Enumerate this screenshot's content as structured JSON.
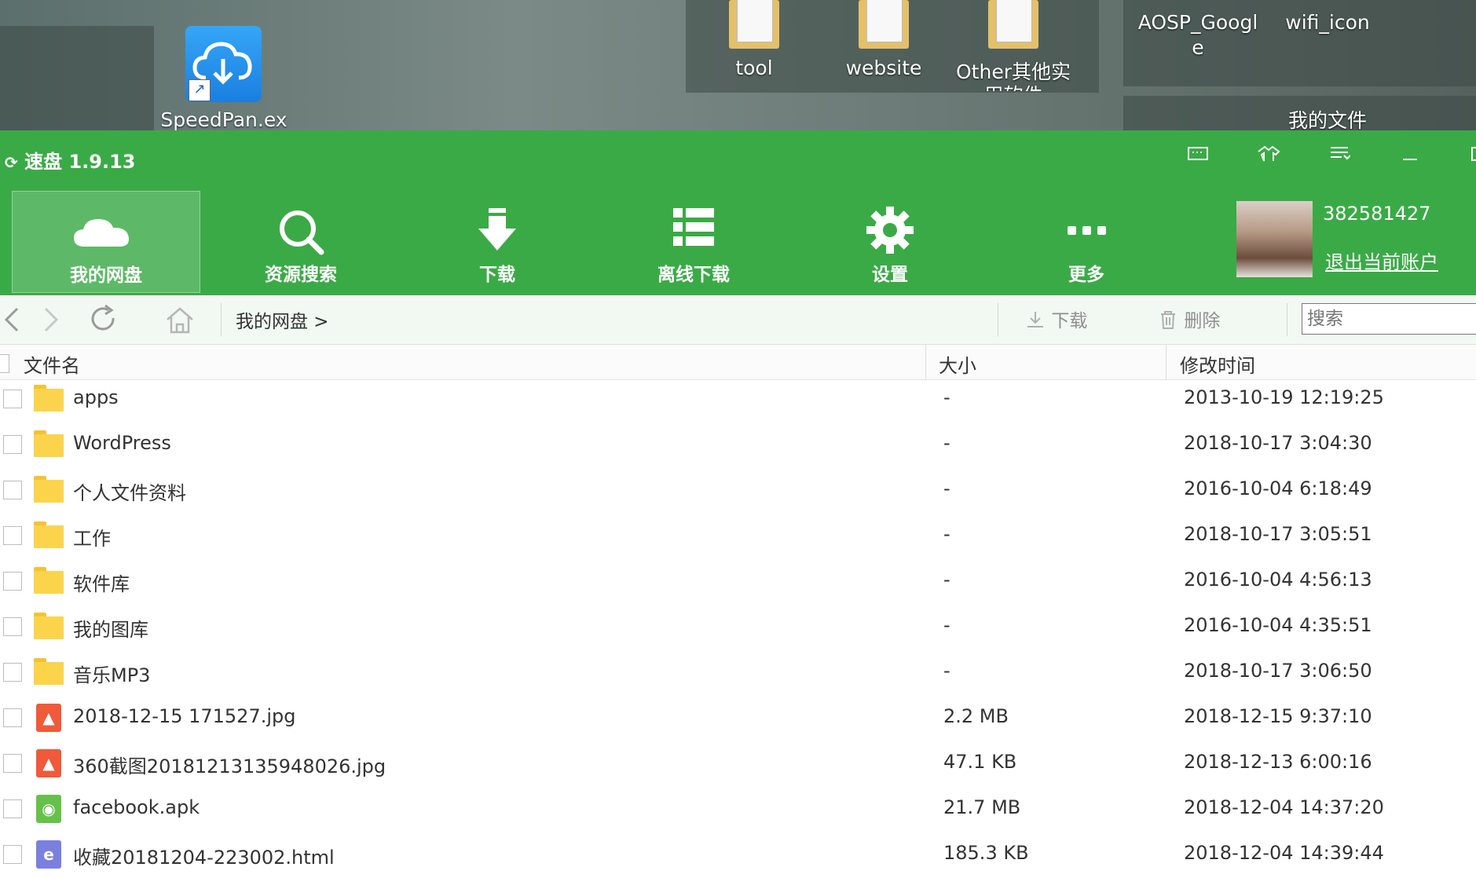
{
  "desktop": {
    "speedpan_label": "SpeedPan.ex",
    "tool_label": "tool",
    "website_label": "website",
    "other_label": "Other其他实",
    "other_label2": "用软件",
    "aosp_label": "AOSP_Googl",
    "aosp_label2": "e",
    "wifi_label": "wifi_icon",
    "myfiles_label": "我的文件"
  },
  "app": {
    "title": "速盘 1.9.13",
    "accent": "#3aaa46"
  },
  "toolbar": {
    "items": [
      {
        "label": "我的网盘",
        "icon": "cloud-icon"
      },
      {
        "label": "资源搜索",
        "icon": "search-icon"
      },
      {
        "label": "下载",
        "icon": "download-arrow-icon"
      },
      {
        "label": "离线下载",
        "icon": "list-icon"
      },
      {
        "label": "设置",
        "icon": "gear-icon"
      },
      {
        "label": "更多",
        "icon": "more-dots-icon"
      }
    ]
  },
  "user": {
    "id": "382581427",
    "logout": "退出当前账户"
  },
  "nav": {
    "breadcrumb": "我的网盘 >",
    "download": "下载",
    "delete": "删除",
    "search_placeholder": "搜索"
  },
  "columns": {
    "name": "文件名",
    "size": "大小",
    "modified": "修改时间"
  },
  "files": [
    {
      "name": "apps",
      "size": "-",
      "time": "2013-10-19 12:19:25",
      "type": "folder"
    },
    {
      "name": "WordPress",
      "size": "-",
      "time": "2018-10-17 3:04:30",
      "type": "folder"
    },
    {
      "name": "个人文件资料",
      "size": "-",
      "time": "2016-10-04 6:18:49",
      "type": "folder"
    },
    {
      "name": "工作",
      "size": "-",
      "time": "2018-10-17 3:05:51",
      "type": "folder"
    },
    {
      "name": "软件库",
      "size": "-",
      "time": "2016-10-04 4:56:13",
      "type": "folder"
    },
    {
      "name": "我的图库",
      "size": "-",
      "time": "2016-10-04 4:35:51",
      "type": "folder"
    },
    {
      "name": "音乐MP3",
      "size": "-",
      "time": "2018-10-17 3:06:50",
      "type": "folder"
    },
    {
      "name": "2018-12-15 171527.jpg",
      "size": "2.2 MB",
      "time": "2018-12-15 9:37:10",
      "type": "image"
    },
    {
      "name": "360截图20181213135948026.jpg",
      "size": "47.1 KB",
      "time": "2018-12-13 6:00:16",
      "type": "image"
    },
    {
      "name": "facebook.apk",
      "size": "21.7 MB",
      "time": "2018-12-04 14:37:20",
      "type": "apk"
    },
    {
      "name": "收藏20181204-223002.html",
      "size": "185.3 KB",
      "time": "2018-12-04 14:39:44",
      "type": "html"
    }
  ]
}
